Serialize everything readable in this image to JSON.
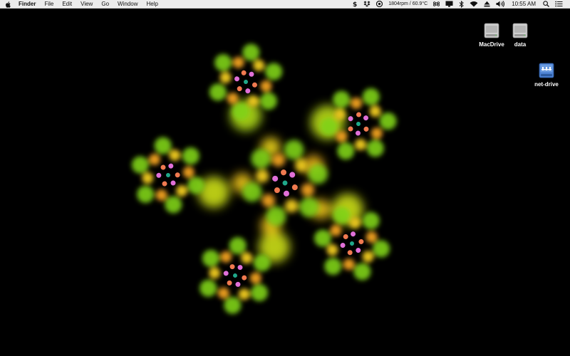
{
  "menubar": {
    "apple_icon": "apple-icon",
    "app_name": "Finder",
    "menus": [
      "File",
      "Edit",
      "View",
      "Go",
      "Window",
      "Help"
    ],
    "status": {
      "fan_readout": "1804rpm / 60.9°C",
      "clock": "10:55 AM",
      "icons": [
        "dollar-icon",
        "dropbox-icon",
        "istat-icon",
        "fan-gauge-icon",
        "command-icon",
        "display-icon",
        "bluetooth-icon",
        "wifi-icon",
        "eject-icon",
        "volume-icon",
        "spotlight-icon",
        "notification-center-icon"
      ]
    }
  },
  "desktop": {
    "icons": [
      {
        "label": "MacDrive",
        "kind": "hard-drive-icon"
      },
      {
        "label": "data",
        "kind": "hard-drive-icon"
      },
      {
        "label": "net-drive",
        "kind": "network-drive-icon"
      }
    ],
    "wallpaper": "kaleidoscope fractal screensaver"
  },
  "colors": {
    "menubar_bg": "#ececec",
    "desktop_bg": "#000000",
    "green": "#8fe31a",
    "yellow": "#f2e21a",
    "orange": "#f0a01e",
    "pink": "#e27ad8"
  }
}
